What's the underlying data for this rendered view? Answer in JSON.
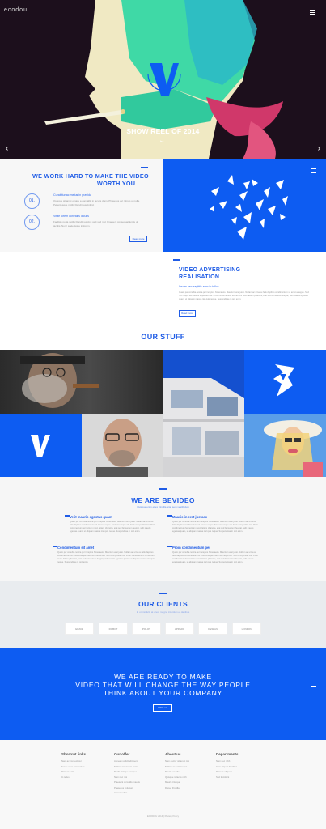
{
  "header": {
    "logo": "ecodou",
    "menu_icon": "hamburger-icon"
  },
  "hero": {
    "title": "SHOW REEL OF 2014",
    "prev_icon": "chevron-left-icon",
    "next_icon": "chevron-right-icon",
    "down_icon": "chevron-down-icon"
  },
  "work": {
    "title_line1": "WE WORK HARD TO MAKE THE VIDEO",
    "title_line2": "WORTH YOU",
    "items": [
      {
        "num": "01.",
        "title": "Curabitur ac metus in gravida",
        "text": "Quisque sit amet ornare a convallis in iaculis diam. Phasellus vel rutrum ut nulla. Pellentesque mollis blandit suscipit id."
      },
      {
        "num": "02.",
        "title": "Vitae lorem convallis iaculis",
        "text": "Facilisis porta mollis blandit suscipit velit sed nisl. Praesent consequat turpis ut iaculis. Nunc scelerisque in lorem."
      }
    ],
    "button": "Read more"
  },
  "advertising": {
    "title_line1": "VIDEO ADVERTISING",
    "title_line2": "REALISATION",
    "subtitle": "Ipsum nec sagittis sem in tellus",
    "text": "Quam per conubia nostra per inceptos himenaeos. Mauris in erat justo. Nullam ac urna eu felis dapibus condimentum sit amet a augue. Sed non neque elit. Sed ut imperdiet nisi. Proin condimentum fermentum nunc. Etiam pharetra, erat sed fermentum feugiat, velit mauris egestas quam, ut aliquam massa nisl quis neque. Suspendisse in orci enim.",
    "button": "Read more"
  },
  "stuff": {
    "title": "OUR STUFF"
  },
  "bevideo": {
    "title": "WE ARE BEVIDEO",
    "subtitle": "Quisque enim et ex fringilla ante sem vestibulum",
    "columns": [
      {
        "title": "Velit mauris egestas quam",
        "text": "Quam per conubia nostra per inceptos himenaeos. Mauris in erat justo. Nullam ac urna eu felis dapibus condimentum sit amet a augue. Sed non neque elit. Sed ut imperdiet nisi. Proin condimentum fermentum nunc. Etiam pharetra, erat sed fermentum feugiat, velit mauris egestas quam, ut aliquam massa nisl quis neque. Suspendisse in orci enim."
      },
      {
        "title": "Mauris in erat justoac",
        "text": "Quam per conubia nostra per inceptos himenaeos. Mauris in erat justo. Nullam ac urna eu felis dapibus condimentum sit amet a augue. Sed non neque elit. Sed ut imperdiet nisi. Proin condimentum fermentum nunc. Etiam pharetra, erat sed fermentum feugiat, velit mauris egestas quam, ut aliquam massa nisl quis neque. Suspendisse in orci enim."
      },
      {
        "title": "Condimentum sit amet",
        "text": "Quam per conubia nostra per inceptos himenaeos. Mauris in erat justo. Nullam ac urna eu felis dapibus condimentum sit amet a augue. Sed non neque elit. Sed ut imperdiet nisi. Proin condimentum fermentum nunc. Etiam pharetra, erat sed fermentum feugiat, velit mauris egestas quam, ut aliquam massa nisl quis neque. Suspendisse in orci enim."
      },
      {
        "title": "Proin condimentum per",
        "text": "Quam per conubia nostra per inceptos himenaeos. Mauris in erat justo. Nullam ac urna eu felis dapibus condimentum sit amet a augue. Sed non neque elit. Sed ut imperdiet nisi. Proin condimentum fermentum nunc. Etiam pharetra, erat sed fermentum feugiat, velit mauris egestas quam, ut aliquam massa nisl quis neque. Suspendisse in orci enim."
      }
    ]
  },
  "clients": {
    "title": "OUR CLIENTS",
    "subtitle": "In ut nisi felis at orem magna interdum et dapibus",
    "logos": [
      "GRAVE",
      "ROBOT",
      "POLOS",
      "APPARO",
      "DESIGN",
      "LONDON"
    ]
  },
  "cta": {
    "line1": "WE ARE READY TO MAKE",
    "line2": "VIDEO THAT WILL CHANGE THE WAY PEOPLE",
    "line3": "THINK ABOUT YOUR COMPANY",
    "button": "Write us"
  },
  "footer": {
    "columns": [
      {
        "title": "Shortcut links",
        "items": [
          "Nam ac consectetur",
          "Fusce vitae fermentum",
          "Proin in erat",
          "In tellus"
        ]
      },
      {
        "title": "Our offer",
        "items": [
          "Aenean sollicitudin sem",
          "Nullam accumsan enim",
          "Morbi tristique semper",
          "Nam nec nisi",
          "Praesent convallis mauris",
          "Phasellus volutpat",
          "Aenean vitae"
        ]
      },
      {
        "title": "About us",
        "items": [
          "Nam auctor sit amet nisi",
          "Nullam ac erat magna",
          "Mauris ut odio",
          "Quisque id lacus nibh",
          "Mauris tristique",
          "Donec fringilla"
        ]
      },
      {
        "title": "Departments",
        "items": [
          "Nam nec nibh",
          "Cras aliquet faucibus",
          "Proin in aliquam",
          "Sed tincidunt"
        ]
      }
    ],
    "copyright": "ECODOU 2014 | Privacy Policy"
  },
  "colors": {
    "brand_blue": "#0d5cf2",
    "title_blue": "#1f5ce6"
  }
}
